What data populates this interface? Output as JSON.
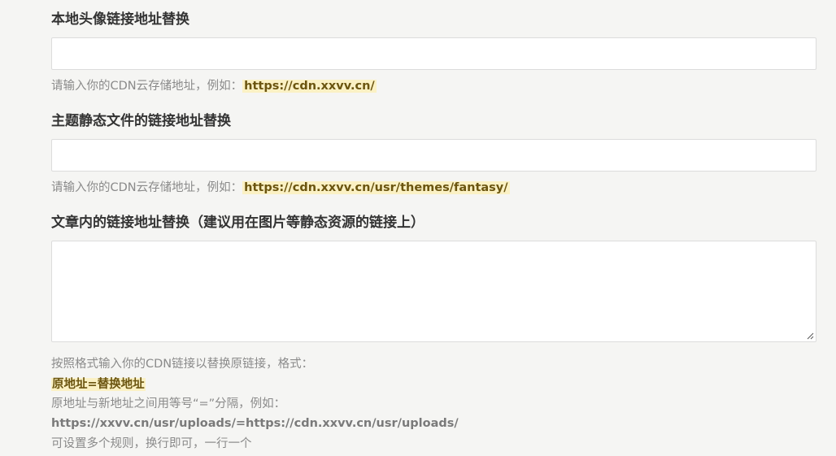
{
  "avatar_cdn": {
    "label": "本地头像链接地址替换",
    "value": "",
    "hint_prefix": "请输入你的CDN云存储地址，例如：",
    "hint_example": "https://cdn.xxvv.cn/"
  },
  "theme_static_cdn": {
    "label": "主题静态文件的链接地址替换",
    "value": "",
    "hint_prefix": "请输入你的CDN云存储地址，例如：",
    "hint_example": "https://cdn.xxvv.cn/usr/themes/fantasy/"
  },
  "article_link_replace": {
    "label": "文章内的链接地址替换（建议用在图片等静态资源的链接上）",
    "value": "",
    "hint_line1": "按照格式输入你的CDN链接以替换原链接，格式：",
    "hint_format": "原地址=替换地址",
    "hint_line3": "原地址与新地址之间用等号“=”分隔，例如：",
    "hint_example": "https://xxvv.cn/usr/uploads/=https://cdn.xxvv.cn/usr/uploads/",
    "hint_line5": "可设置多个规则，换行即可，一行一个"
  },
  "icons": {
    "resize": "resize-grip-icon"
  },
  "colors": {
    "background": "#f5f5f3",
    "highlight_bg": "#fbf1c4",
    "highlight_text": "#6b5510",
    "hint_text": "#8a8a8a",
    "label_text": "#333333"
  }
}
